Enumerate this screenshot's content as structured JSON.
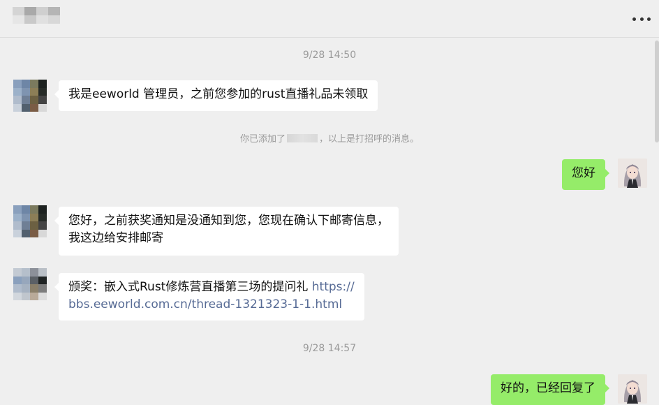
{
  "header": {
    "more_icon": "more-dots-icon"
  },
  "messages": {
    "ts1": "9/28 14:50",
    "m1": "我是eeworld 管理员，之前您参加的rust直播礼品未领取",
    "sys_prefix": "你已添加了",
    "sys_suffix": "，以上是打招呼的消息。",
    "m2": "您好",
    "m3_line1": "您好，之前获奖通知是没通知到您，您现在确认下邮寄信息，",
    "m3_line2": "我这边给安排邮寄",
    "m4_text": "颁奖：嵌入式Rust修炼营直播第三场的提问礼 ",
    "m4_link1": "https://",
    "m4_link2": "bbs.eeworld.com.cn/thread-1321323-1-1.html",
    "ts2": "9/28 14:57",
    "m5": "好的，已经回复了"
  },
  "colors": {
    "background": "#efefef",
    "bubble_in": "#ffffff",
    "bubble_out": "#95ec69",
    "link": "#576b95",
    "timestamp": "#9a9a9a"
  }
}
